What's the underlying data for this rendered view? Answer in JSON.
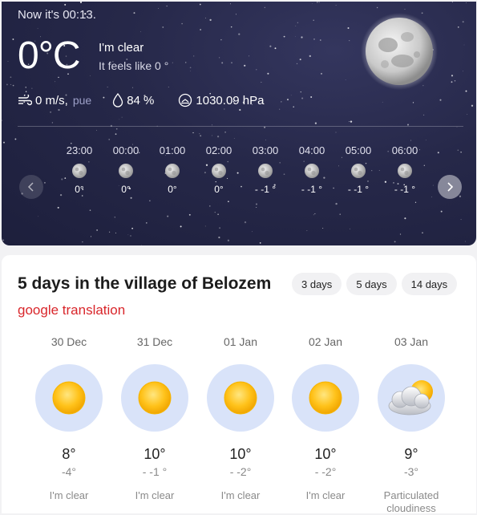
{
  "now": {
    "time_text": "Now it's 00:13.",
    "temperature": "0°C",
    "condition": "I'm clear",
    "feels_like": "It feels like 0 °",
    "wind": "0 m/s,",
    "wind_dir": "pue",
    "humidity": "84 %",
    "pressure": "1030.09 hPa",
    "icon": "moon-icon"
  },
  "hourly": [
    {
      "time": "23:00",
      "temp": "0°",
      "icon": "moon-icon"
    },
    {
      "time": "00:00",
      "temp": "0°",
      "icon": "moon-icon"
    },
    {
      "time": "01:00",
      "temp": "0°",
      "icon": "moon-icon"
    },
    {
      "time": "02:00",
      "temp": "0°",
      "icon": "moon-icon"
    },
    {
      "time": "03:00",
      "temp": "- -1 °",
      "icon": "moon-icon"
    },
    {
      "time": "04:00",
      "temp": "- -1 °",
      "icon": "moon-icon"
    },
    {
      "time": "05:00",
      "temp": "- -1 °",
      "icon": "moon-icon"
    },
    {
      "time": "06:00",
      "temp": "- -1 °",
      "icon": "moon-icon"
    }
  ],
  "forecast": {
    "title": "5 days in the village of Belozem",
    "ranges": [
      "3 days",
      "5 days",
      "14 days"
    ],
    "translation_link": "google translation",
    "days": [
      {
        "date": "30 Dec",
        "high": "8°",
        "low": "-4°",
        "desc": "I'm clear",
        "icon": "sun-icon"
      },
      {
        "date": "31 Dec",
        "high": "10°",
        "low": "- -1 °",
        "desc": "I'm clear",
        "icon": "sun-icon"
      },
      {
        "date": "01 Jan",
        "high": "10°",
        "low": "- -2°",
        "desc": "I'm clear",
        "icon": "sun-icon"
      },
      {
        "date": "02 Jan",
        "high": "10°",
        "low": "- -2°",
        "desc": "I'm clear",
        "icon": "sun-icon"
      },
      {
        "date": "03 Jan",
        "high": "9°",
        "low": "-3°",
        "desc": "Particulated cloudiness",
        "icon": "sun-behind-cloud-icon"
      }
    ]
  },
  "colors": {
    "night_bg": "#262849",
    "accent_red": "#d9262b",
    "day_icon_bg": "#d9e3f9",
    "sun": "#ffc21a"
  }
}
